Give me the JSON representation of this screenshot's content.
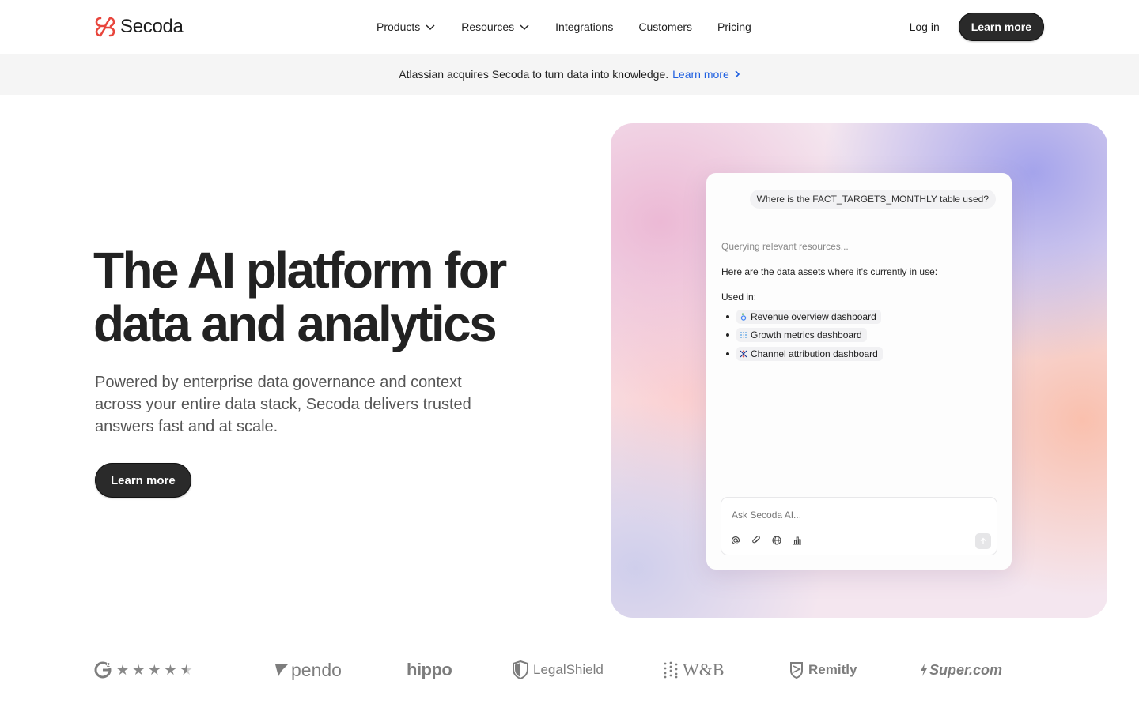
{
  "brand": {
    "name": "Secoda",
    "accent": "#e8453c"
  },
  "nav": {
    "items": [
      {
        "label": "Products",
        "has_dropdown": true
      },
      {
        "label": "Resources",
        "has_dropdown": true
      },
      {
        "label": "Integrations",
        "has_dropdown": false
      },
      {
        "label": "Customers",
        "has_dropdown": false
      },
      {
        "label": "Pricing",
        "has_dropdown": false
      }
    ],
    "login_label": "Log in",
    "cta_label": "Learn more"
  },
  "banner": {
    "text": "Atlassian acquires Secoda to turn data into knowledge.",
    "link_label": "Learn more",
    "link_color": "#1e5fe0"
  },
  "hero": {
    "title_line1": "The AI platform for",
    "title_line2": "data and analytics",
    "subtitle": "Powered by enterprise data governance and context across your entire data stack, Secoda delivers trusted answers fast and at scale.",
    "cta_label": "Learn more"
  },
  "chat": {
    "user_question": "Where is the FACT_TARGETS_MONTHLY table used?",
    "status": "Querying relevant resources...",
    "answer_intro": "Here are the data assets where it's currently in use:",
    "used_in_label": "Used in:",
    "assets": [
      {
        "label": "Revenue overview dashboard",
        "icon": "looker-icon"
      },
      {
        "label": "Growth metrics dashboard",
        "icon": "metabase-icon"
      },
      {
        "label": "Channel attribution dashboard",
        "icon": "tableau-icon"
      }
    ],
    "input_placeholder": "Ask Secoda AI...",
    "tools": [
      "mention-icon",
      "attach-icon",
      "globe-icon",
      "chart-icon"
    ]
  },
  "social_proof": {
    "rating_source": "G2",
    "stars": 4.5,
    "customers": [
      "pendo",
      "hippo",
      "LegalShield",
      "W&B",
      "Remitly",
      "Super.com"
    ]
  }
}
